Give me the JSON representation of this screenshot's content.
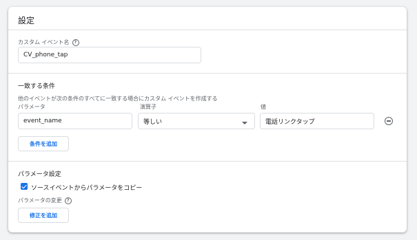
{
  "card": {
    "title": "設定"
  },
  "custom_event": {
    "label": "カスタム イベント名",
    "value": "CV_phone_tap"
  },
  "conditions": {
    "heading": "一致する条件",
    "description": "他のイベントが次の条件のすべてに一致する場合にカスタム イベントを作成する",
    "col_param": "パラメータ",
    "col_operator": "演算子",
    "col_value": "値",
    "param_value": "event_name",
    "operator_value": "等しい",
    "value_value": "電話リンクタップ",
    "add_condition_label": "条件を追加"
  },
  "parameter_settings": {
    "heading": "パラメータ設定",
    "copy_checkbox_label": "ソースイベントからパラメータをコピー",
    "copy_checked": true,
    "modify_label": "パラメータの変更",
    "add_modification_label": "修正を追加"
  },
  "icons": {
    "help": "help-circle-icon",
    "remove": "remove-circle-icon",
    "dropdown": "chevron-down-icon",
    "check": "check-icon"
  },
  "colors": {
    "accent": "#1a73e8",
    "border": "#dadce0",
    "divider": "#e0e0e0"
  }
}
